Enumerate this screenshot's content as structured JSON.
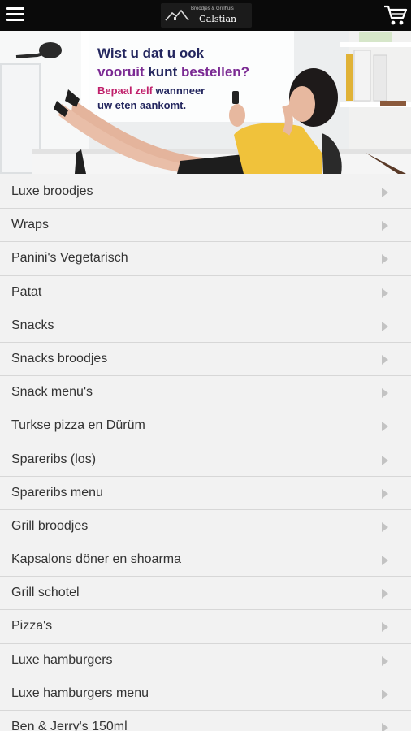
{
  "header": {
    "logo_tagline": "Broodjes & Grillhuis",
    "logo_name": "Galstian",
    "menu_icon": "hamburger-menu-icon",
    "cart_icon": "shopping-cart-icon"
  },
  "banner": {
    "line1": "Wist u dat u ook",
    "line2_a": "vooruit",
    "line2_b": "kunt",
    "line2_c": "bestellen?",
    "line3_a": "Bepaal zelf",
    "line3_b": "wannneer",
    "line4": "uw eten aankomt."
  },
  "categories": [
    {
      "label": "Luxe broodjes"
    },
    {
      "label": "Wraps"
    },
    {
      "label": "Panini's Vegetarisch"
    },
    {
      "label": "Patat"
    },
    {
      "label": "Snacks"
    },
    {
      "label": "Snacks broodjes"
    },
    {
      "label": "Snack menu's"
    },
    {
      "label": "Turkse pizza en Dürüm"
    },
    {
      "label": "Spareribs (los)"
    },
    {
      "label": "Spareribs menu"
    },
    {
      "label": "Grill broodjes"
    },
    {
      "label": "Kapsalons döner en shoarma"
    },
    {
      "label": "Grill schotel"
    },
    {
      "label": "Pizza's"
    },
    {
      "label": "Luxe hamburgers"
    },
    {
      "label": "Luxe hamburgers menu"
    },
    {
      "label": "Ben & Jerry's 150ml"
    }
  ],
  "colors": {
    "topbar": "#0a0a0a",
    "list_background": "#f2f2f2",
    "banner_navy": "#23265e",
    "banner_purple": "#7b2a93",
    "banner_pink": "#c0206b"
  }
}
